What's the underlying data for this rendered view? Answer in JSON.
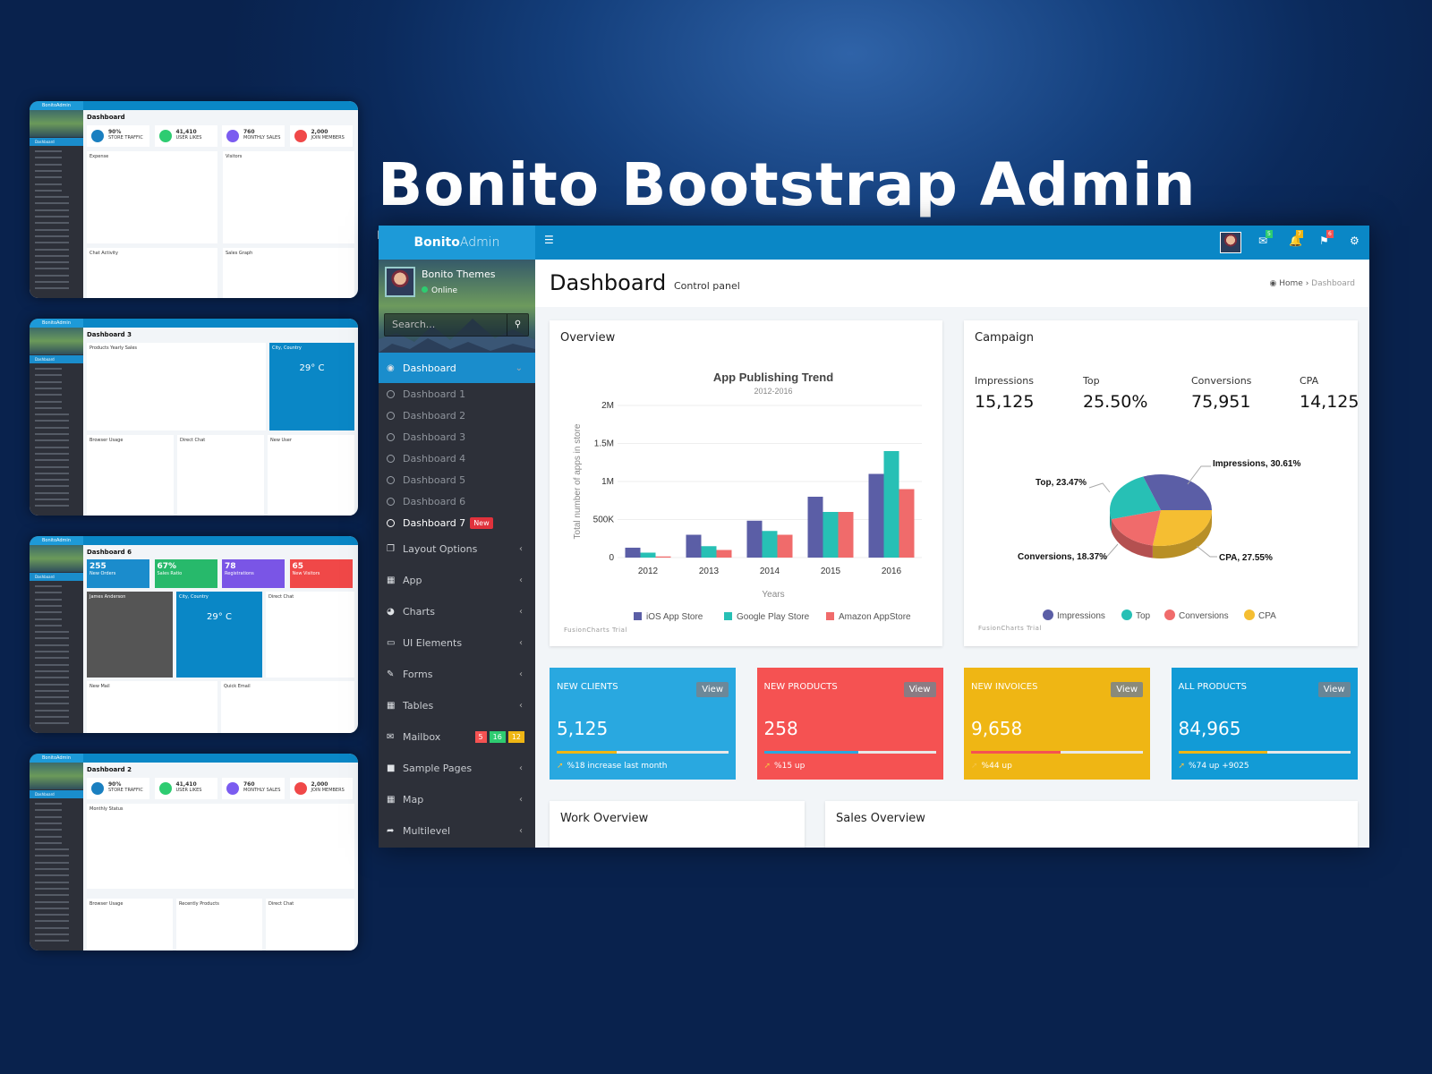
{
  "hero_title": "Bonito Bootstrap Admin Template",
  "colors": {
    "primary": "#0a87c6",
    "sidebar": "#2d3039",
    "ios": "#5b5ea6",
    "google": "#27c0b5",
    "amazon": "#f06b6b",
    "cpa": "#f5be32",
    "red": "#f55252",
    "yellow": "#efb614",
    "blue_card": "#29a8e0",
    "blue_card2": "#129bd6"
  },
  "app": {
    "logo_bold": "Bonito",
    "logo_light": "Admin",
    "user_name": "Bonito Themes",
    "user_status": "Online",
    "search_placeholder": "Search...",
    "icons": {
      "menu": "hamburger-icon",
      "mail": "envelope-icon",
      "bell": "bell-icon",
      "flag": "flag-icon",
      "gear": "gear-icon",
      "search": "search-icon"
    },
    "badges": {
      "mail": "5",
      "bell": "7",
      "flag": "6"
    }
  },
  "sidebar": {
    "active": "Dashboard",
    "subitems": [
      "Dashboard 1",
      "Dashboard 2",
      "Dashboard 3",
      "Dashboard 4",
      "Dashboard 5",
      "Dashboard 6",
      "Dashboard 7"
    ],
    "new_badge": "New",
    "items": [
      {
        "label": "Layout Options",
        "icon": "clone-icon"
      },
      {
        "label": "App",
        "icon": "grid-icon"
      },
      {
        "label": "Charts",
        "icon": "pie-chart-icon"
      },
      {
        "label": "UI Elements",
        "icon": "laptop-icon"
      },
      {
        "label": "Forms",
        "icon": "edit-icon"
      },
      {
        "label": "Tables",
        "icon": "table-icon"
      },
      {
        "label": "Mailbox",
        "icon": "envelope-icon"
      },
      {
        "label": "Sample Pages",
        "icon": "folder-icon"
      },
      {
        "label": "Map",
        "icon": "map-icon"
      },
      {
        "label": "Multilevel",
        "icon": "share-icon"
      }
    ],
    "mailbox_badges": [
      "5",
      "16",
      "12"
    ]
  },
  "page": {
    "title": "Dashboard",
    "subtitle": "Control panel",
    "breadcrumb": [
      "Home",
      "Dashboard"
    ]
  },
  "overview": {
    "title": "Overview",
    "watermark": "FusionCharts Trial"
  },
  "campaign": {
    "title": "Campaign",
    "watermark": "FusionCharts Trial",
    "kpis": [
      {
        "label": "Impressions",
        "value": "15,125"
      },
      {
        "label": "Top",
        "value": "25.50%"
      },
      {
        "label": "Conversions",
        "value": "75,951"
      },
      {
        "label": "CPA",
        "value": "14,125"
      }
    ]
  },
  "stats": [
    {
      "label": "NEW CLIENTS",
      "value": "5,125",
      "view": "View",
      "foot": "%18 increase last month",
      "progress": 35,
      "bar_color": "#efb614",
      "bg": "#29a8e0"
    },
    {
      "label": "NEW PRODUCTS",
      "value": "258",
      "view": "View",
      "foot": "%15 up",
      "progress": 55,
      "bar_color": "#29a8e0",
      "bg": "#f55252"
    },
    {
      "label": "NEW INVOICES",
      "value": "9,658",
      "view": "View",
      "foot": "%44 up",
      "progress": 52,
      "bar_color": "#f55252",
      "bg": "#efb614"
    },
    {
      "label": "ALL PRODUCTS",
      "value": "84,965",
      "view": "View",
      "foot": "%74 up +9025",
      "progress": 52,
      "bar_color": "#efb614",
      "bg": "#129bd6"
    }
  ],
  "bottom": {
    "work": "Work Overview",
    "sales": "Sales Overview"
  },
  "chart_data": [
    {
      "type": "bar",
      "title": "App Publishing Trend",
      "subtitle": "2012-2016",
      "xlabel": "Years",
      "ylabel": "Total number of apps in store",
      "ylim": [
        0,
        2000000
      ],
      "yticks": [
        "0",
        "500K",
        "1M",
        "1.5M",
        "2M"
      ],
      "ytick_values": [
        0,
        500000,
        1000000,
        1500000,
        2000000
      ],
      "grid": true,
      "legend": "bottom",
      "categories": [
        "2012",
        "2013",
        "2014",
        "2015",
        "2016"
      ],
      "series": [
        {
          "name": "iOS App Store",
          "values": [
            130000,
            300000,
            485000,
            800000,
            1100000
          ]
        },
        {
          "name": "Google Play Store",
          "values": [
            65000,
            150000,
            350000,
            600000,
            1400000
          ]
        },
        {
          "name": "Amazon AppStore",
          "values": [
            15000,
            100000,
            300000,
            600000,
            900000
          ]
        }
      ]
    },
    {
      "type": "pie",
      "legend": "bottom",
      "labels": [
        "Impressions",
        "Top",
        "Conversions",
        "CPA"
      ],
      "values": [
        30.61,
        23.47,
        18.37,
        27.55
      ],
      "data_labels": [
        "Impressions, 30.61%",
        "Top, 23.47%",
        "Conversions, 18.37%",
        "CPA, 27.55%"
      ]
    }
  ],
  "thumbs": [
    {
      "title": "Dashboard",
      "subtitle": "Control panel",
      "boxes": [
        [
          "90%",
          "STORE TRAFFIC"
        ],
        [
          "41,410",
          "USER LIKES"
        ],
        [
          "760",
          "MONTHLY SALES"
        ],
        [
          "2,000",
          "JOIN MEMBERS"
        ]
      ],
      "panels": [
        "Expense",
        "Visitors",
        "Chat Activity",
        "Sales Graph"
      ]
    },
    {
      "title": "Dashboard 3",
      "panels": [
        "Products Yearly Sales",
        "City, Country",
        "Browser Usage",
        "Direct Chat",
        "New User"
      ],
      "temp": "29° C"
    },
    {
      "title": "Dashboard 6",
      "boxes": [
        [
          "255",
          "New Orders"
        ],
        [
          "67%",
          "Sales Ratio"
        ],
        [
          "78",
          "Registrations"
        ],
        [
          "65",
          "New Visitors"
        ]
      ],
      "panels": [
        "James Anderson",
        "City, Country",
        "Direct Chat",
        "New Mail",
        "Quick Email"
      ],
      "temp": "29° C"
    },
    {
      "title": "Dashboard 2",
      "boxes": [
        [
          "90%",
          "STORE TRAFFIC"
        ],
        [
          "41,410",
          "USER LIKES"
        ],
        [
          "760",
          "MONTHLY SALES"
        ],
        [
          "2,000",
          "JOIN MEMBERS"
        ]
      ],
      "panels": [
        "Monthly Status",
        "Browser Usage",
        "Recently Products",
        "Direct Chat"
      ]
    }
  ]
}
